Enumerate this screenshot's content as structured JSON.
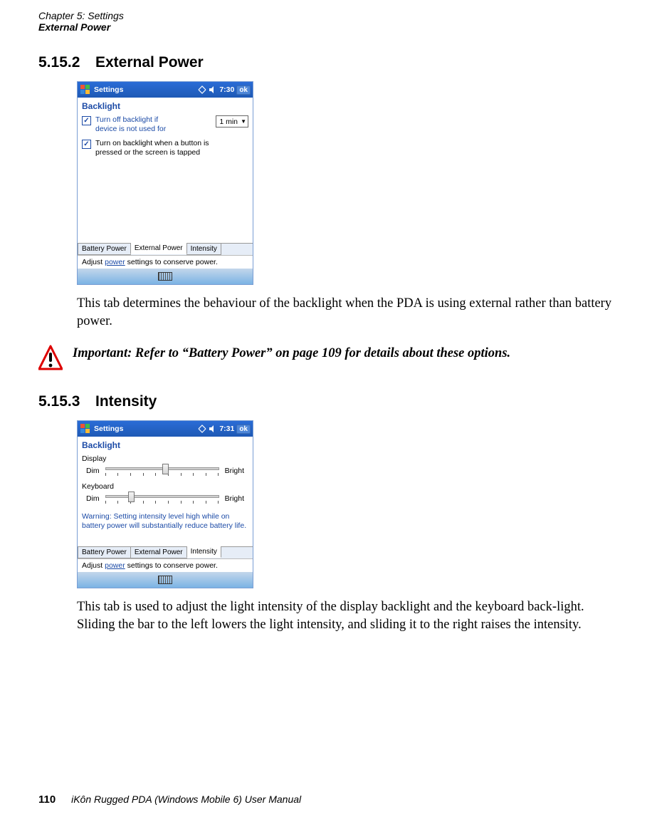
{
  "header": {
    "chapter": "Chapter 5:  Settings",
    "section": "External Power"
  },
  "sections": {
    "s1": {
      "num": "5.15.2",
      "title": "External Power"
    },
    "s2": {
      "num": "5.15.3",
      "title": "Intensity"
    }
  },
  "shot1": {
    "title": "Settings",
    "time": "7:30",
    "ok": "ok",
    "heading": "Backlight",
    "opt1": "Turn off backlight if device is not used for",
    "opt1_checked": "☑",
    "dd_value": "1 min",
    "opt2": "Turn on backlight when a button is pressed or the screen is tapped",
    "opt2_checked": "☑",
    "tabs": {
      "t1": "Battery Power",
      "t2": "External Power",
      "t3": "Intensity"
    },
    "hint_pre": "Adjust ",
    "hint_link": "power",
    "hint_post": " settings to conserve power."
  },
  "body1": "This tab determines the behaviour of the backlight when the PDA is using external rather than battery power.",
  "note": {
    "label": "Important:  ",
    "text": "Refer to “Battery Power” on page 109 for details about these options."
  },
  "shot2": {
    "title": "Settings",
    "time": "7:31",
    "ok": "ok",
    "heading": "Backlight",
    "display_label": "Display",
    "keyboard_label": "Keyboard",
    "dim": "Dim",
    "bright": "Bright",
    "warn": "Warning: Setting intensity level high while on battery power will substantially reduce battery life.",
    "tabs": {
      "t1": "Battery Power",
      "t2": "External Power",
      "t3": "Intensity"
    },
    "hint_pre": "Adjust ",
    "hint_link": "power",
    "hint_post": " settings to conserve power."
  },
  "body2": "This tab is used to adjust the light intensity of the display backlight and the keyboard back-light. Sliding the bar to the left lowers the light intensity, and sliding it to the right raises the intensity.",
  "footer": {
    "page": "110",
    "book": "iKôn Rugged PDA (Windows Mobile 6) User Manual"
  },
  "chart_data": {
    "type": "table",
    "note": "Slider positions on a 0–10 tick scale as depicted",
    "sliders": [
      {
        "name": "Display",
        "min_label": "Dim",
        "max_label": "Bright",
        "ticks": 10,
        "value": 5
      },
      {
        "name": "Keyboard",
        "min_label": "Dim",
        "max_label": "Bright",
        "ticks": 10,
        "value": 2
      }
    ]
  }
}
